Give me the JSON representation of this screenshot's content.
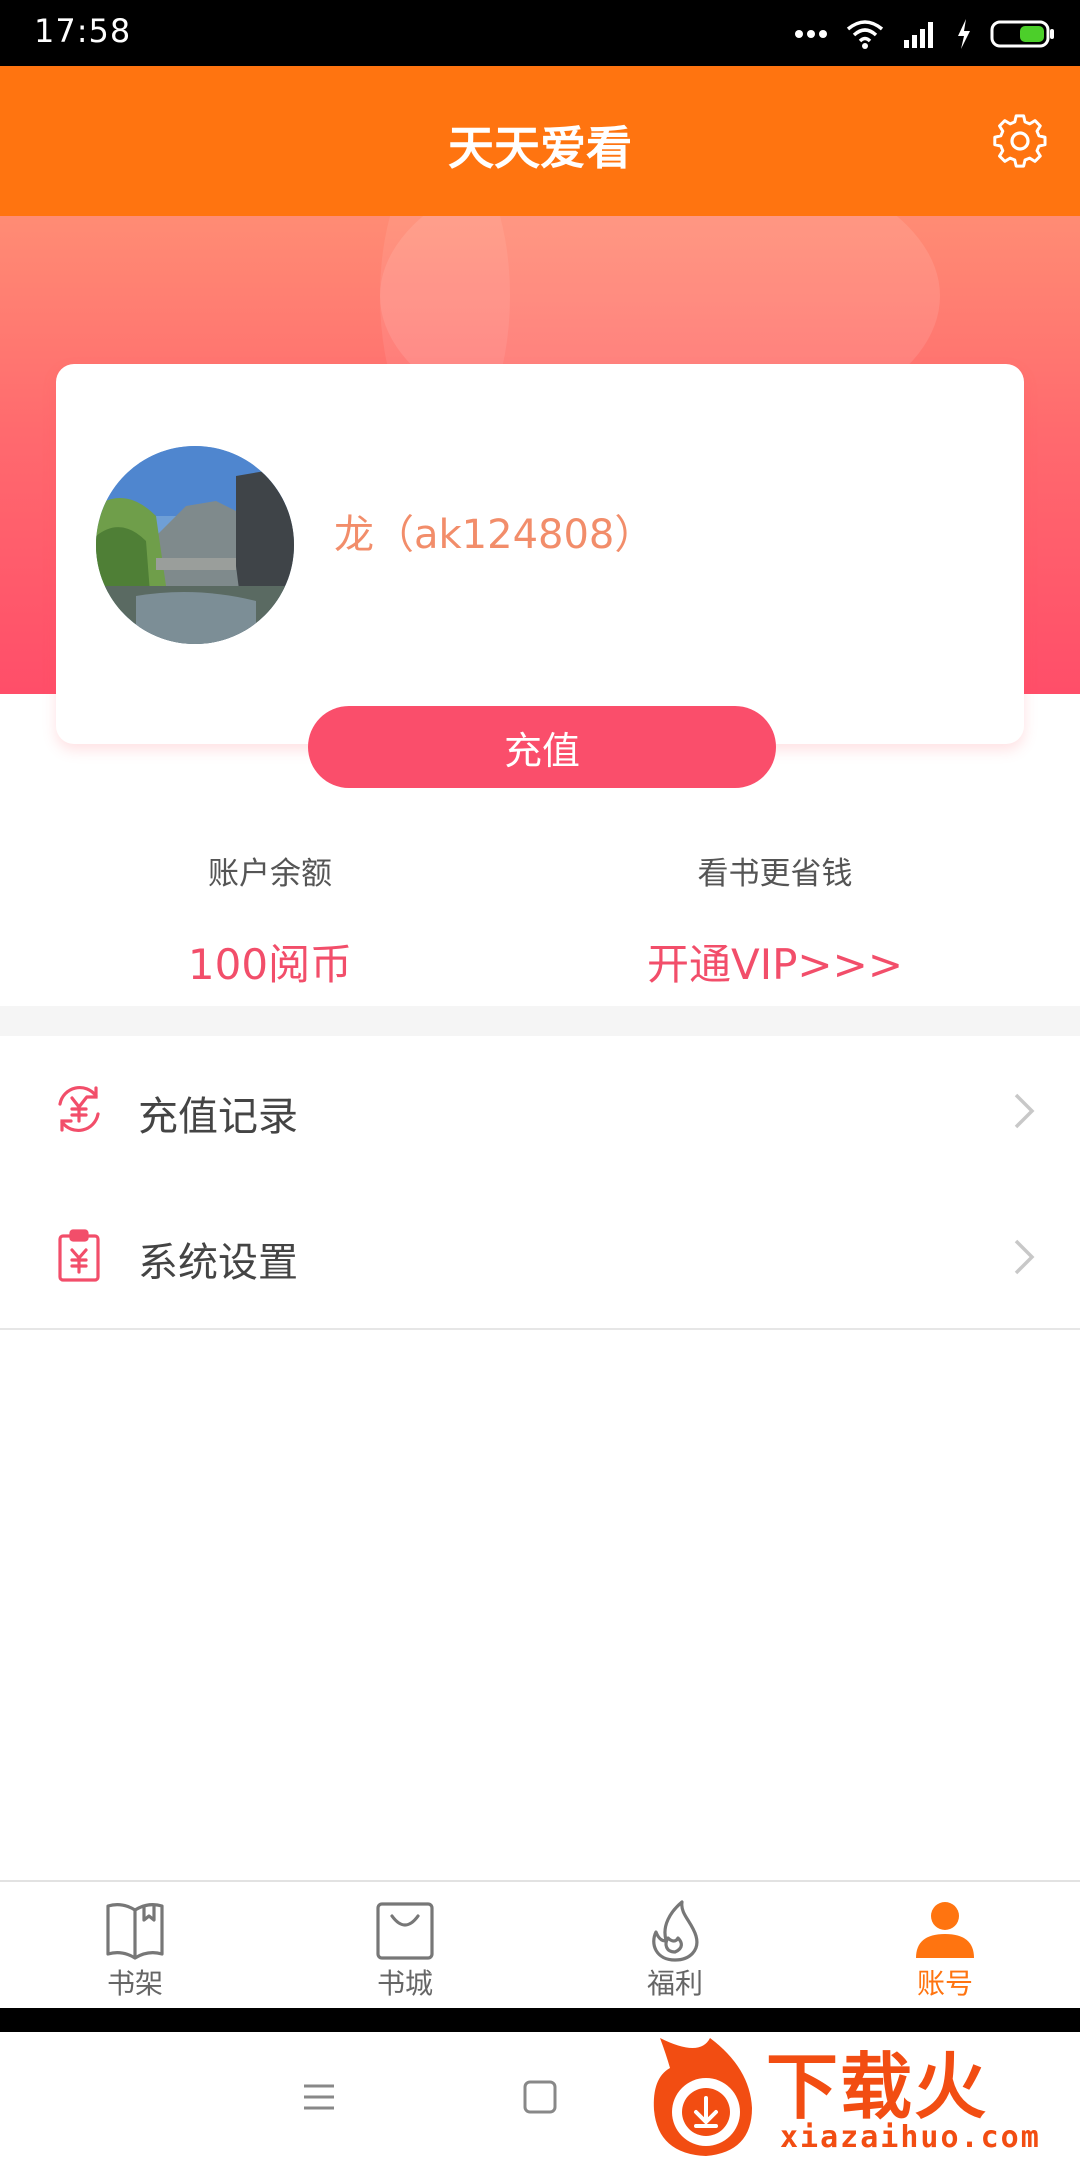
{
  "status_bar": {
    "time": "17:58"
  },
  "header": {
    "title": "天天爱看"
  },
  "profile": {
    "username": "龙（ak124808）"
  },
  "recharge_button": {
    "label": "充值"
  },
  "stats": {
    "balance": {
      "label": "账户余额",
      "value": "100阅币"
    },
    "vip": {
      "label": "看书更省钱",
      "value": "开通VIP>>>"
    }
  },
  "menu": [
    {
      "label": "充值记录",
      "icon": "recharge-record-icon"
    },
    {
      "label": "系统设置",
      "icon": "settings-clipboard-icon"
    }
  ],
  "tabs": [
    {
      "label": "书架",
      "icon": "bookshelf-icon",
      "active": false
    },
    {
      "label": "书城",
      "icon": "bookstore-bag-icon",
      "active": false
    },
    {
      "label": "福利",
      "icon": "welfare-flame-icon",
      "active": false
    },
    {
      "label": "账号",
      "icon": "account-person-icon",
      "active": true
    }
  ],
  "watermark": {
    "brand": "下载火",
    "domain": "xiazaihuo.com"
  },
  "colors": {
    "header": "#ff7410",
    "accent": "#fa4e6b",
    "username": "#f28d6a",
    "active_tab": "#ff7410"
  }
}
